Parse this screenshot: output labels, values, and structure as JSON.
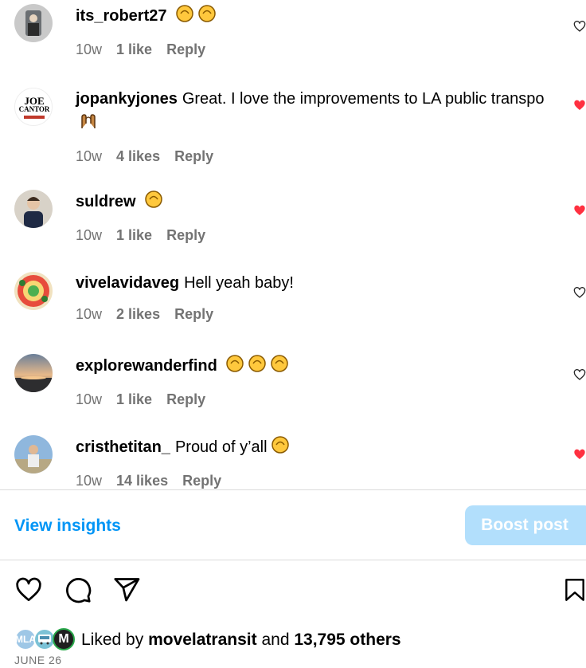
{
  "comments": [
    {
      "username": "its_robert27",
      "text": "",
      "emoji_count": 2,
      "emoji": "clapping-hands",
      "time": "10w",
      "likes": "1 like",
      "reply": "Reply",
      "liked": false
    },
    {
      "username": "jopankyjones",
      "text": "Great. I love the improvements to LA public transpo",
      "emoji_count": 1,
      "emoji": "raising-hands",
      "time": "10w",
      "likes": "4 likes",
      "reply": "Reply",
      "liked": true
    },
    {
      "username": "suldrew",
      "text": "",
      "emoji_count": 1,
      "emoji": "clapping-hands",
      "time": "10w",
      "likes": "1 like",
      "reply": "Reply",
      "liked": true
    },
    {
      "username": "vivelavidaveg",
      "text": "Hell yeah baby!",
      "emoji_count": 0,
      "emoji": "",
      "time": "10w",
      "likes": "2 likes",
      "reply": "Reply",
      "liked": false
    },
    {
      "username": "explorewanderfind",
      "text": "",
      "emoji_count": 3,
      "emoji": "clapping-hands",
      "time": "10w",
      "likes": "1 like",
      "reply": "Reply",
      "liked": false
    },
    {
      "username": "cristhetitan_",
      "text": "Proud of y’all",
      "emoji_count": 1,
      "emoji": "clapping-hands",
      "time": "10w",
      "likes": "14 likes",
      "reply": "Reply",
      "liked": true
    }
  ],
  "avatar_2_label_top": "JOE",
  "avatar_2_label_bottom": "CANTOR",
  "insights_label": "View insights",
  "boost_label": "Boost post",
  "liked_by": {
    "prefix": "Liked by",
    "user": "movelatransit",
    "middle": "and",
    "count": "13,795 others",
    "avatar_labels": [
      "MLA",
      "",
      "M"
    ]
  },
  "date": "JUNE 26",
  "colors": {
    "accent": "#0095f6",
    "boost_bg": "#b2dffc",
    "heart_red": "#ff3040",
    "meta_gray": "#737373"
  },
  "icons": [
    "heart-icon",
    "comment-icon",
    "share-icon",
    "bookmark-icon"
  ]
}
